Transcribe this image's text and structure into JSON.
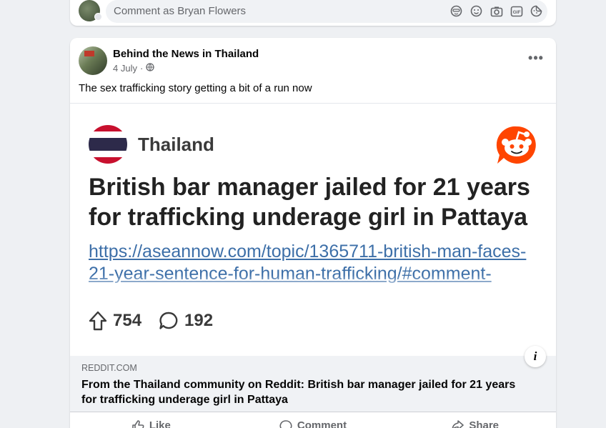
{
  "comment_bar": {
    "placeholder": "Comment as Bryan Flowers",
    "tool_icons": [
      "avatar-sticker-icon",
      "emoji-icon",
      "camera-icon",
      "gif-icon",
      "sticker-icon"
    ]
  },
  "post": {
    "author": "Behind the News in Thailand",
    "date": "4 July",
    "separator": "·",
    "audience_icon": "globe-icon",
    "more_label": "•••",
    "text": "The sex trafficking story getting a bit of a run now",
    "shared_image": {
      "subreddit": "Thailand",
      "headline": "British bar manager jailed for 21 years for trafficking underage girl in Pattaya",
      "link_line1": "https://aseannow.com/topic/1365711-british-man-faces-",
      "link_line2": "21-year-sentence-for-human-trafficking/#comment-",
      "upvotes": "754",
      "comments": "192",
      "colors": {
        "flag_red": "#c8102e",
        "flag_white": "#ffffff",
        "flag_blue": "#2d2a4a",
        "reddit_orange": "#ff4500"
      }
    },
    "link_preview": {
      "domain": "REDDIT.COM",
      "title": "From the Thailand community on Reddit: British bar manager jailed for 21 years for trafficking underage girl in Pattaya",
      "info_label": "i"
    },
    "actions": {
      "like": "Like",
      "comment": "Comment",
      "share": "Share"
    }
  }
}
